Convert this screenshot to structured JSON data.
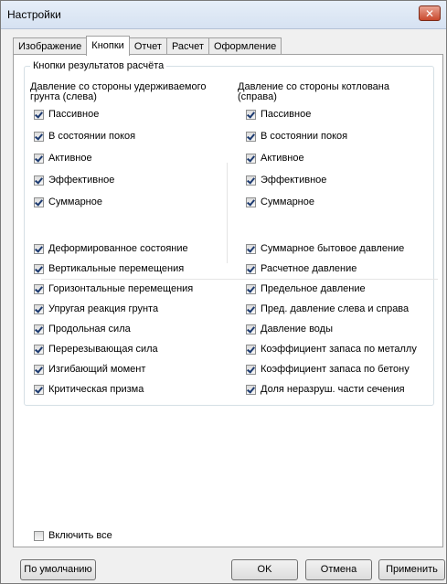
{
  "window": {
    "title": "Настройки",
    "close_label": "✕"
  },
  "tabs": [
    {
      "label": "Изображение",
      "active": false
    },
    {
      "label": "Кнопки",
      "active": true
    },
    {
      "label": "Отчет",
      "active": false
    },
    {
      "label": "Расчет",
      "active": false
    },
    {
      "label": "Оформление",
      "active": false
    }
  ],
  "group": {
    "title": "Кнопки результатов расчёта",
    "left_heading": "Давление со стороны удерживаемого грунта (слева)",
    "right_heading": "Давление со стороны котлована (справа)",
    "left_items": [
      {
        "label": "Пассивное",
        "checked": true
      },
      {
        "label": "В состоянии покоя",
        "checked": true
      },
      {
        "label": "Активное",
        "checked": true
      },
      {
        "label": "Эффективное",
        "checked": true
      },
      {
        "label": "Суммарное",
        "checked": true
      }
    ],
    "right_items": [
      {
        "label": "Пассивное",
        "checked": true
      },
      {
        "label": "В состоянии покоя",
        "checked": true
      },
      {
        "label": "Активное",
        "checked": true
      },
      {
        "label": "Эффективное",
        "checked": true
      },
      {
        "label": "Суммарное",
        "checked": true
      }
    ],
    "bottom_left_items": [
      {
        "label": "Деформированное состояние",
        "checked": true
      },
      {
        "label": "Вертикальные перемещения",
        "checked": true
      },
      {
        "label": "Горизонтальные перемещения",
        "checked": true
      },
      {
        "label": "Упругая реакция грунта",
        "checked": true
      },
      {
        "label": "Продольная сила",
        "checked": true
      },
      {
        "label": "Перерезывающая сила",
        "checked": true
      },
      {
        "label": "Изгибающий момент",
        "checked": true
      },
      {
        "label": "Критическая призма",
        "checked": true
      }
    ],
    "bottom_right_items": [
      {
        "label": "Суммарное бытовое давление",
        "checked": true
      },
      {
        "label": "Расчетное давление",
        "checked": true
      },
      {
        "label": "Предельное давление",
        "checked": true
      },
      {
        "label": "Пред. давление слева и справа",
        "checked": true
      },
      {
        "label": "Давление воды",
        "checked": true
      },
      {
        "label": "Коэффициент запаса по металлу",
        "checked": true
      },
      {
        "label": "Коэффициент запаса по бетону",
        "checked": true
      },
      {
        "label": "Доля неразруш. части сечения",
        "checked": true
      }
    ]
  },
  "enable_all": {
    "label": "Включить все",
    "checked": false
  },
  "buttons": {
    "defaults": "По умолчанию",
    "ok": "OK",
    "cancel": "Отмена",
    "apply": "Применить"
  }
}
